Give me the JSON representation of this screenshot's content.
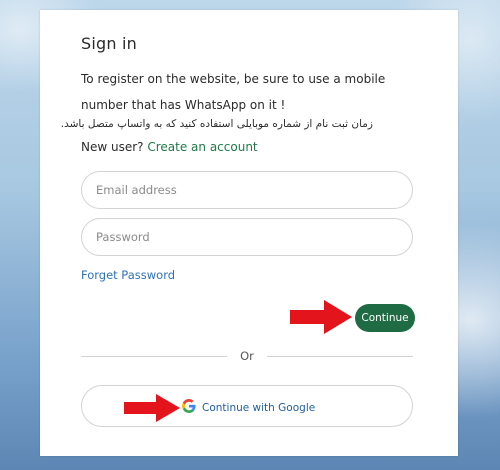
{
  "signin": {
    "title": "Sign in",
    "info_en": "To register on the website, be sure to use a mobile number that has WhatsApp on it !",
    "info_fa": "زمان ثبت نام از شماره موبایلی استفاده کنید که به واتساپ متصل باشد.",
    "new_user_prefix": "New user? ",
    "create_account_label": "Create an account",
    "email_placeholder": "Email address",
    "password_placeholder": "Password",
    "forgot_label": "Forget Password",
    "continue_label": "Continue",
    "or_label": "Or",
    "google_label": "Continue with Google"
  },
  "icons": {
    "google": "google-icon",
    "arrow": "red-arrow-icon"
  },
  "colors": {
    "primary_green": "#1f6b43",
    "link_green": "#1e7a46",
    "link_blue": "#2f72b5",
    "google_text": "#1f5e9c",
    "arrow_red": "#e3141b"
  }
}
